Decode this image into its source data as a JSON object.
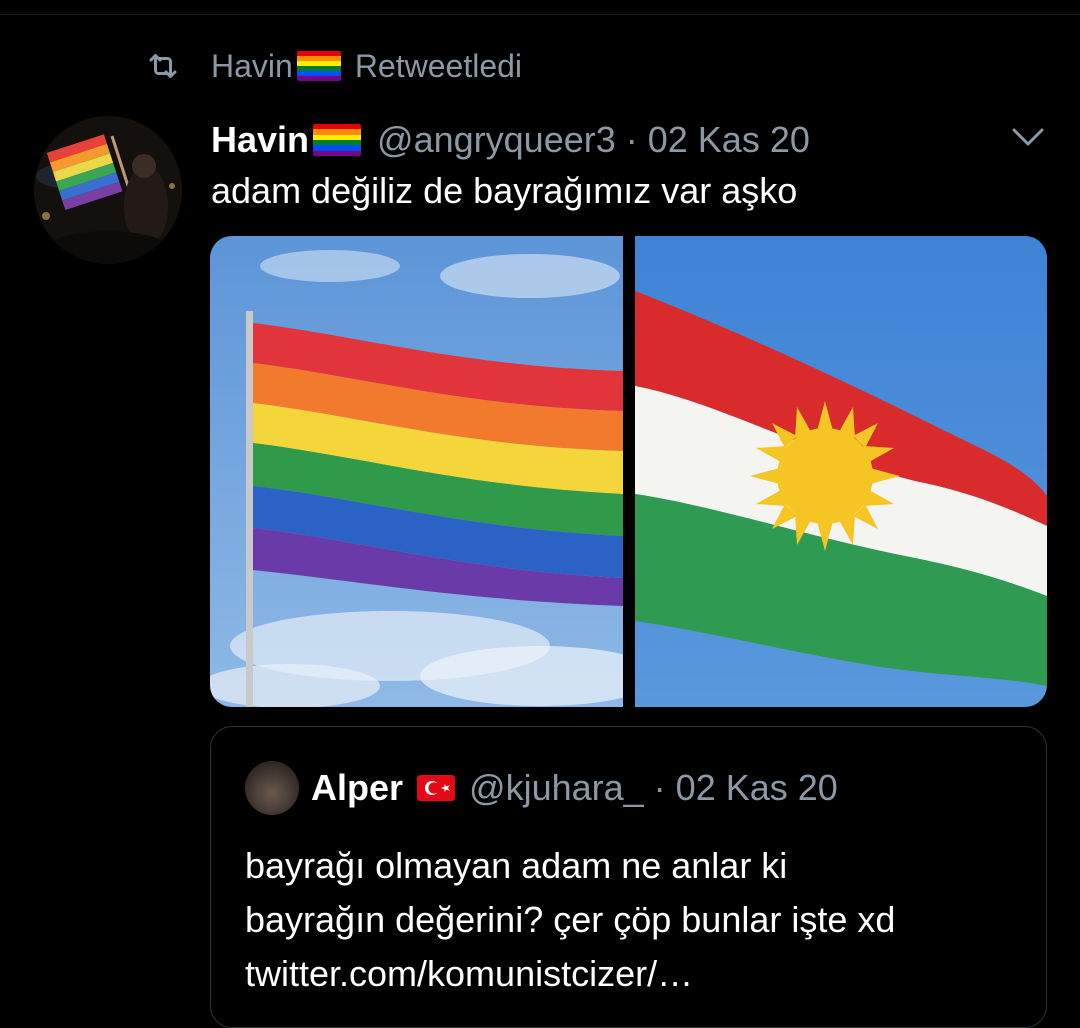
{
  "retweet": {
    "icon": "retweet-icon",
    "name": "Havin",
    "name_emoji": "rainbow-flag-emoji",
    "label": "Retweetledi"
  },
  "tweet": {
    "author_name": "Havin",
    "author_emoji": "rainbow-flag-emoji",
    "handle": "@angryqueer3",
    "separator": "·",
    "date": "02 Kas 20",
    "menu_icon": "chevron-down-icon",
    "text": "adam değiliz de bayrağımız var aşko",
    "media": [
      {
        "icon": "rainbow-flag-photo"
      },
      {
        "icon": "kurdistan-flag-photo"
      }
    ]
  },
  "quoted": {
    "author_name": "Alper",
    "author_emoji": "turkey-flag-emoji",
    "handle": "@kjuhara_",
    "separator": "·",
    "date": "02 Kas 20",
    "text_lines": [
      "bayrağı olmayan adam ne anlar ki",
      "bayrağın değerini? çer çöp bunlar işte xd",
      "twitter.com/komunistcizer/…"
    ]
  },
  "colors": {
    "background": "#000000",
    "secondary_text": "#8b98a5",
    "quote_border": "#2f3336"
  }
}
